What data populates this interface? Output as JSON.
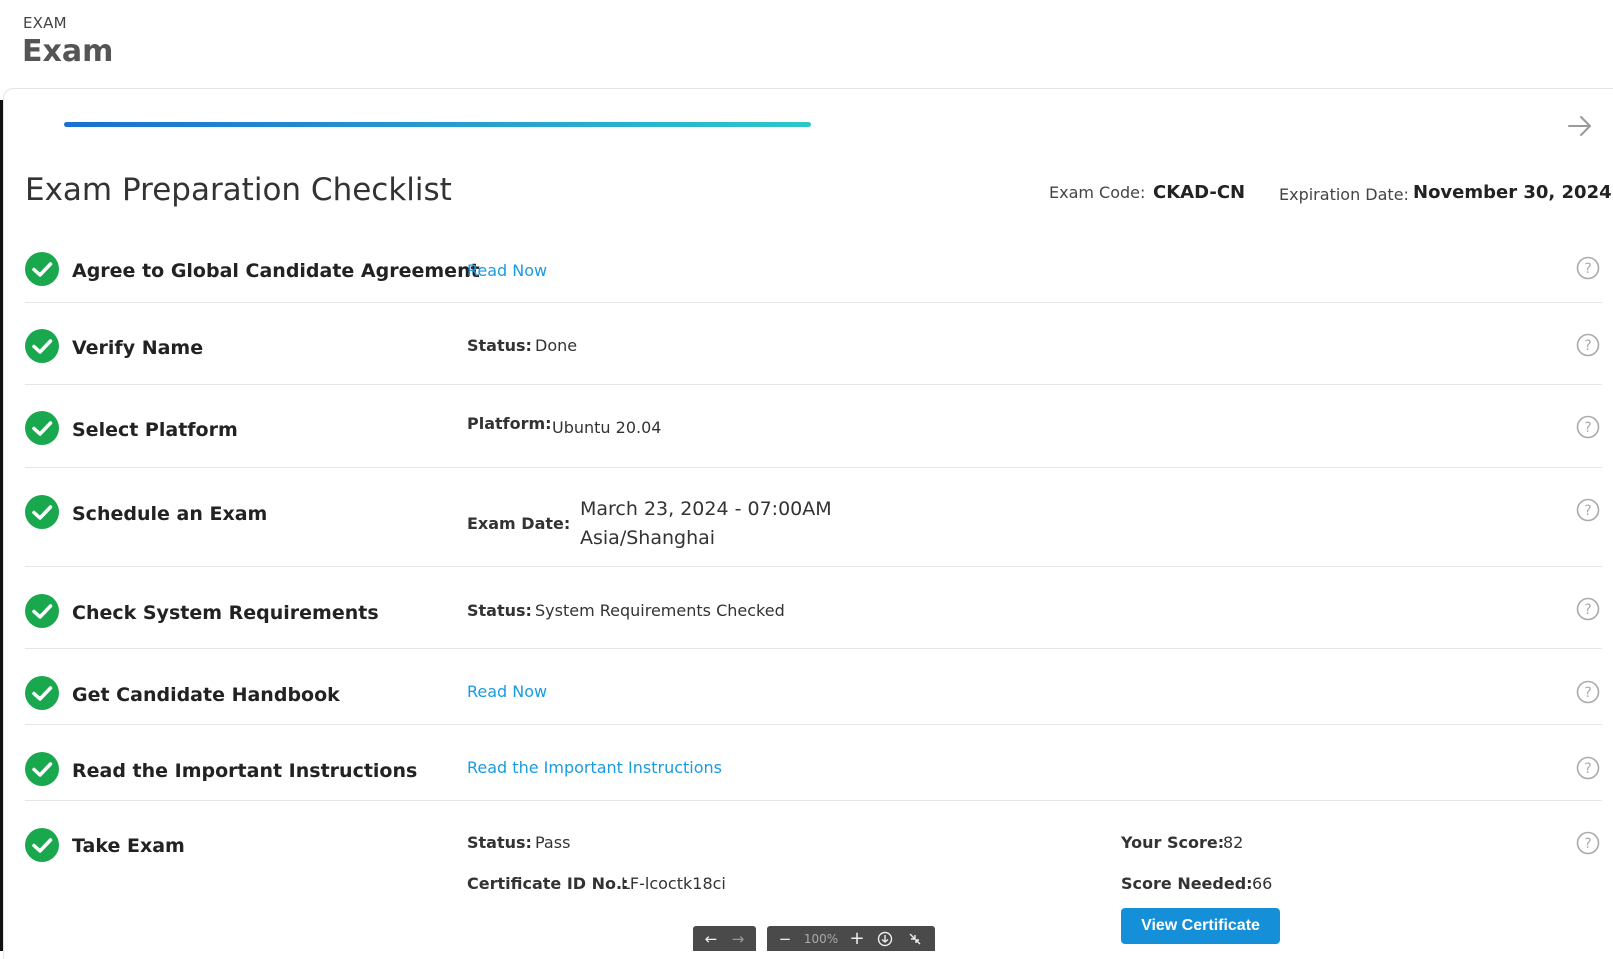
{
  "header": {
    "section_label": "EXAM",
    "page_title": "Exam"
  },
  "progress": {
    "fraction": 0.47
  },
  "checklist": {
    "title": "Exam Preparation Checklist",
    "exam_code_label": "Exam Code:",
    "exam_code": "CKAD-CN",
    "expiration_label": "Expiration Date:",
    "expiration": "November 30, 2024"
  },
  "rows": [
    {
      "title": "Agree to Global Candidate Agreement",
      "link": "Read Now"
    },
    {
      "title": "Verify Name",
      "label": "Status:",
      "value": "Done"
    },
    {
      "title": "Select Platform",
      "label": "Platform:",
      "value": "Ubuntu 20.04"
    },
    {
      "title": "Schedule an Exam",
      "label": "Exam Date:",
      "value_line1": "March 23, 2024 - 07:00AM",
      "value_line2": "Asia/Shanghai"
    },
    {
      "title": "Check System Requirements",
      "label": "Status:",
      "value": "System Requirements Checked"
    },
    {
      "title": "Get Candidate Handbook",
      "link": "Read Now"
    },
    {
      "title": "Read the Important Instructions",
      "link": "Read the Important Instructions"
    },
    {
      "title": "Take Exam",
      "status_label": "Status:",
      "status_value": "Pass",
      "cert_label": "Certificate ID No.:",
      "cert_value": "LF-lcoctk18ci",
      "score_label": "Your Score:",
      "score_value": "82",
      "needed_label": "Score Needed:",
      "needed_value": "66",
      "button": "View Certificate"
    }
  ],
  "pdf_toolbar": {
    "zoom": "100%"
  },
  "colors": {
    "check": "#1aa84f",
    "link": "#1a9be0",
    "button": "#1590d8"
  }
}
